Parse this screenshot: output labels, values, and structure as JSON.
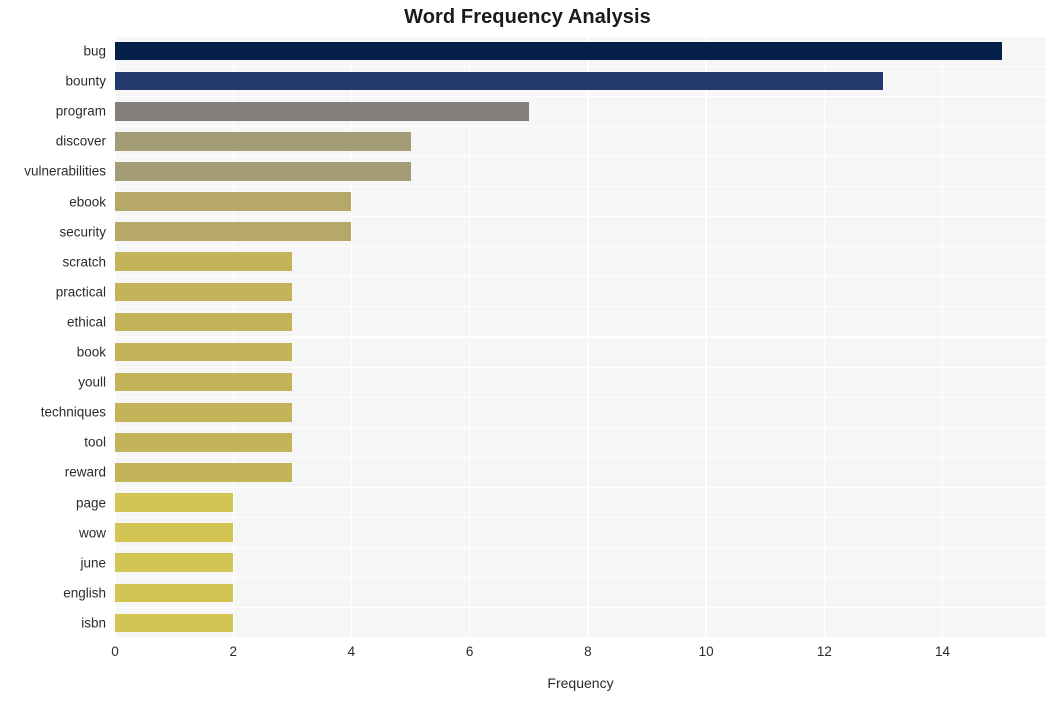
{
  "chart_data": {
    "type": "bar",
    "orientation": "horizontal",
    "title": "Word Frequency Analysis",
    "xlabel": "Frequency",
    "ylabel": "",
    "categories": [
      "bug",
      "bounty",
      "program",
      "discover",
      "vulnerabilities",
      "ebook",
      "security",
      "scratch",
      "practical",
      "ethical",
      "book",
      "youll",
      "techniques",
      "tool",
      "reward",
      "page",
      "wow",
      "june",
      "english",
      "isbn"
    ],
    "values": [
      15,
      13,
      7,
      5,
      5,
      4,
      4,
      3,
      3,
      3,
      3,
      3,
      3,
      3,
      3,
      2,
      2,
      2,
      2,
      2
    ],
    "bar_colors": [
      "#042048",
      "#243a6d",
      "#827f7b",
      "#a39c74",
      "#a39c74",
      "#b5a868",
      "#b5a868",
      "#c3b45a",
      "#c3b45a",
      "#c3b45a",
      "#c3b45a",
      "#c3b45a",
      "#c3b45a",
      "#c3b45a",
      "#c3b45a",
      "#d3c553",
      "#d3c553",
      "#d3c553",
      "#d3c553",
      "#d3c553"
    ],
    "xlim": [
      0,
      15.75
    ],
    "xticks": [
      0,
      2,
      4,
      6,
      8,
      10,
      12,
      14
    ],
    "xtick_labels": [
      "0",
      "2",
      "4",
      "6",
      "8",
      "10",
      "12",
      "14"
    ],
    "grid": true,
    "grid_color": "#ffffff",
    "plot_background": "#f6f6f6",
    "figure_background": "#ffffff",
    "legend": null
  }
}
